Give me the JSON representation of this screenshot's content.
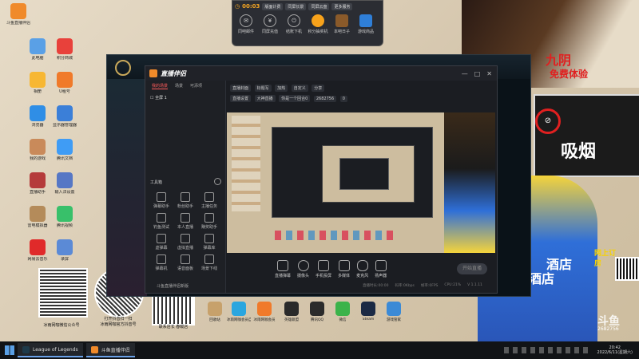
{
  "desktop": {
    "icons": [
      {
        "label": "斗鱼直播伴侣",
        "color": "#f08a2a"
      },
      {
        "label": "此电脑",
        "color": "#5aa0e6"
      },
      {
        "label": "积分商城",
        "color": "#e8413b"
      },
      {
        "label": "相册",
        "color": "#f7b733"
      },
      {
        "label": "U租号",
        "color": "#f07a2a"
      },
      {
        "label": "浏览器",
        "color": "#2f8ee6"
      },
      {
        "label": "显示器管理器",
        "color": "#3b7fd8"
      },
      {
        "label": "我的游戏",
        "color": "#c98a5a"
      },
      {
        "label": "腾讯文档",
        "color": "#3f9cf5"
      },
      {
        "label": "直播助手",
        "color": "#b53b3b"
      },
      {
        "label": "输入法设置",
        "color": "#5677c5"
      },
      {
        "label": "雷电模拟器",
        "color": "#b48b5a"
      },
      {
        "label": "腾讯视频",
        "color": "#38c06a"
      },
      {
        "label": "网易云音乐",
        "color": "#e02a2a"
      },
      {
        "label": "录屏",
        "color": "#5b8ad6"
      }
    ],
    "qr_captions": [
      "冰雨网咖微信公众号",
      "打开抖音扫一扫\n冰雨网咖官方抖音号",
      "联系店长 春暖店"
    ],
    "dock": [
      {
        "label": "回收站",
        "color": "#c7a16b"
      },
      {
        "label": "冰雨网咖会员自助服务",
        "color": "#2aa6df"
      },
      {
        "label": "冰雨网咖会员",
        "color": "#f07a2a"
      },
      {
        "label": "英雄联盟",
        "color": "#2a2a2a"
      },
      {
        "label": "腾讯QQ",
        "color": "#2b2b2b"
      },
      {
        "label": "微信",
        "color": "#3bb34a"
      },
      {
        "label": "Steam",
        "color": "#1b2a44"
      },
      {
        "label": "游戏管家",
        "color": "#3b8ad6"
      }
    ]
  },
  "toolbar": {
    "timer": "00:03",
    "chips": [
      "版面计费",
      "同屏长景",
      "同屏云盘",
      "更多服务"
    ],
    "buttons": [
      {
        "label": "同吧邮件",
        "glyph": "✉"
      },
      {
        "label": "同屏充值",
        "glyph": "¥"
      },
      {
        "label": "结账下机",
        "glyph": "⏻"
      },
      {
        "label": "积分抽奖机",
        "color": "#f7a21b"
      },
      {
        "label": "本吧日子",
        "color": "#8a5a2a"
      },
      {
        "label": "游戏商品",
        "color": "#2f7fd8"
      }
    ]
  },
  "app": {
    "title": "直播伴侣",
    "sidebar_tabs": [
      "我的场景",
      "场景",
      "可添项"
    ],
    "scene_item": "全屏 1",
    "tools_header": "工具箱",
    "tools": [
      "弹幕助手",
      "粉丝助手",
      "主播任务",
      "钓鱼测试",
      "本人直播",
      "赚奖助手",
      "虚弹幕",
      "虚拟直播",
      "弹幕库",
      "弹幕机",
      "语音面板",
      "场景下线"
    ],
    "footer_text": "斗鱼直播伴侣新版",
    "header_chips": [
      "直播封面",
      "标题写",
      "加热",
      "自定义",
      "分享"
    ],
    "room_info": [
      "直播设置",
      "大神直播",
      "你是一个回合0",
      "2682756",
      "0"
    ],
    "controls": [
      "直播弹幕",
      "摄像头",
      "手机投屏",
      "多媒体",
      "麦克风",
      "扬声器"
    ],
    "start_button": "开始直播",
    "status": [
      "直播时长:00:00",
      "码率:0Kbps",
      "帧率:0FPS",
      "CPU:21%"
    ],
    "version": "V 1.1.11"
  },
  "taskbar": {
    "items": [
      {
        "label": "League of Legends",
        "color": "#1e3a4a"
      },
      {
        "label": "斗鱼直播伴侣",
        "color": "#f08a2a"
      }
    ],
    "time": "20:42",
    "date": "2022/6/11(星期六)"
  },
  "posters": {
    "top": "免费体验",
    "smoke": "吸烟",
    "hotel1": "酒店",
    "hotel2": "酒店",
    "book": "网上订房",
    "logo": "斗鱼",
    "room_id": "2682756",
    "big_title": "九阴"
  }
}
